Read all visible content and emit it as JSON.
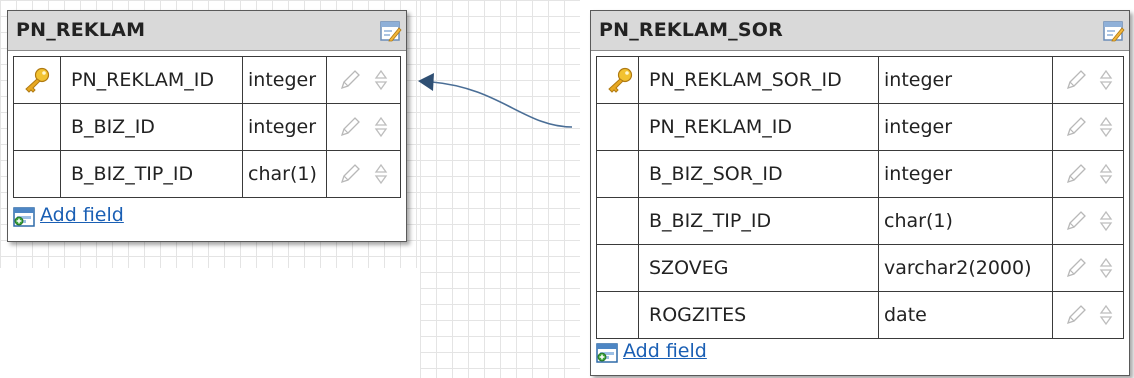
{
  "diagram": {
    "tables": [
      {
        "name": "PN_REKLAM",
        "fields": [
          {
            "name": "PN_REKLAM_ID",
            "type": "integer",
            "primary_key": true
          },
          {
            "name": "B_BIZ_ID",
            "type": "integer",
            "primary_key": false
          },
          {
            "name": "B_BIZ_TIP_ID",
            "type": "char(1)",
            "primary_key": false
          }
        ],
        "add_field_label": "Add field"
      },
      {
        "name": "PN_REKLAM_SOR",
        "fields": [
          {
            "name": "PN_REKLAM_SOR_ID",
            "type": "integer",
            "primary_key": true
          },
          {
            "name": "PN_REKLAM_ID",
            "type": "integer",
            "primary_key": false
          },
          {
            "name": "B_BIZ_SOR_ID",
            "type": "integer",
            "primary_key": false
          },
          {
            "name": "B_BIZ_TIP_ID",
            "type": "char(1)",
            "primary_key": false
          },
          {
            "name": "SZOVEG",
            "type": "varchar2(2000)",
            "primary_key": false
          },
          {
            "name": "ROGZITES",
            "type": "date",
            "primary_key": false
          }
        ],
        "add_field_label": "Add field"
      }
    ],
    "relationship": {
      "from": "PN_REKLAM_SOR.PN_REKLAM_ID",
      "to": "PN_REKLAM.PN_REKLAM_ID"
    }
  },
  "colors": {
    "header_bg": "#d9d9d9",
    "link": "#1a5fb4",
    "connector": "#4a6e96",
    "key": "#e0a820"
  },
  "icons": [
    "edit-table-icon",
    "primary-key-icon",
    "pencil-icon",
    "reorder-arrows-icon",
    "add-field-icon"
  ]
}
